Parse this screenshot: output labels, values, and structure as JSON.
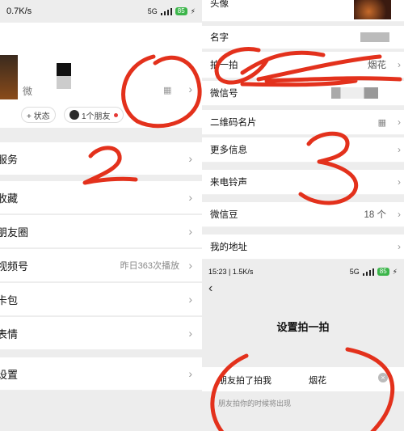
{
  "left": {
    "status_speed": "0.7K/s",
    "status_network": "5G",
    "status_battery": "85",
    "profile_name_fragment": "微",
    "status_pill": "+ 状态",
    "friends_pill": "1个朋友",
    "menu": [
      {
        "label": "服务",
        "value": ""
      },
      {
        "label": "收藏",
        "value": ""
      },
      {
        "label": "朋友圈",
        "value": ""
      },
      {
        "label": "视频号",
        "value": "昨日363次播放"
      },
      {
        "label": "卡包",
        "value": ""
      },
      {
        "label": "表情",
        "value": ""
      },
      {
        "label": "设置",
        "value": ""
      }
    ]
  },
  "right": {
    "rows": [
      {
        "label": "头像",
        "value": ""
      },
      {
        "label": "名字",
        "value": ""
      },
      {
        "label": "拍一拍",
        "value": "烟花"
      },
      {
        "label": "微信号",
        "value": ""
      },
      {
        "label": "二维码名片",
        "value": ""
      },
      {
        "label": "更多信息",
        "value": ""
      },
      {
        "label": "来电铃声",
        "value": ""
      },
      {
        "label": "微信豆",
        "value": "18 个"
      },
      {
        "label": "我的地址",
        "value": ""
      }
    ],
    "status_time": "15:23 | 1.5K/s",
    "status_network": "5G",
    "status_battery": "85",
    "page_title": "设置拍一拍",
    "form_label": "朋友拍了拍我",
    "form_value": "烟花",
    "form_hint": "朋友拍你的时候将出现"
  },
  "colors": {
    "annotation": "#e3311c",
    "accent": "#07c160",
    "battery": "#3bb54a"
  }
}
